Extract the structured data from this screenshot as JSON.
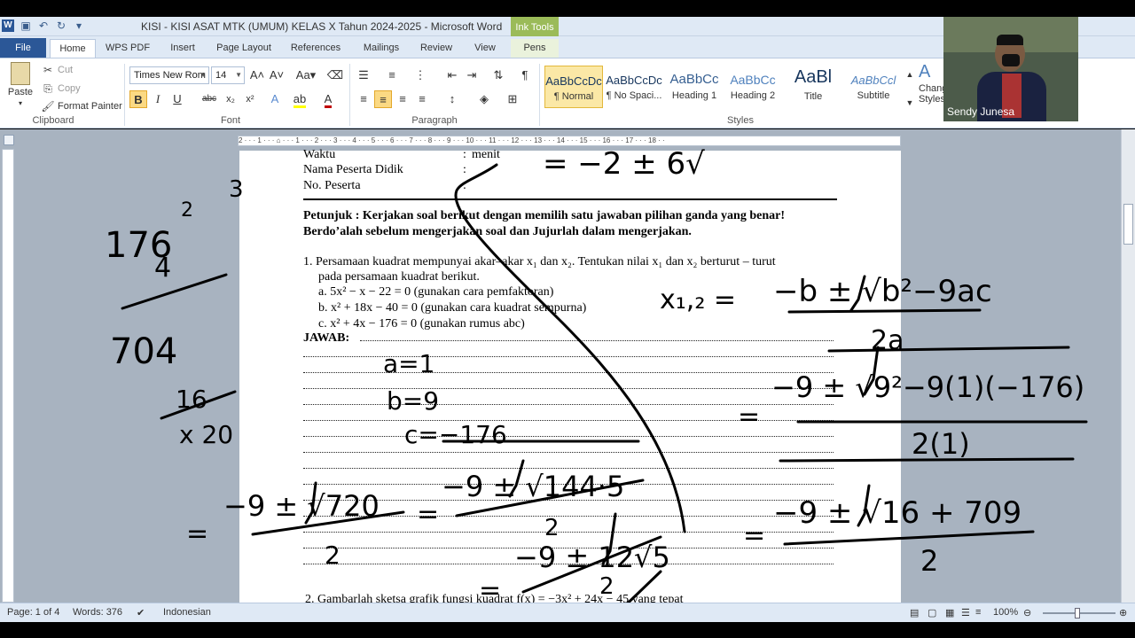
{
  "window": {
    "title": "KISI - KISI ASAT MTK (UMUM) KELAS X Tahun 2024-2025  -  Microsoft Word",
    "contextual_tab_group": "Ink Tools"
  },
  "tabs": [
    {
      "label": "File"
    },
    {
      "label": "Home"
    },
    {
      "label": "WPS PDF"
    },
    {
      "label": "Insert"
    },
    {
      "label": "Page Layout"
    },
    {
      "label": "References"
    },
    {
      "label": "Mailings"
    },
    {
      "label": "Review"
    },
    {
      "label": "View"
    },
    {
      "label": "Pens"
    }
  ],
  "clipboard": {
    "paste": "Paste",
    "cut": "Cut",
    "copy": "Copy",
    "format_painter": "Format Painter",
    "label": "Clipboard"
  },
  "font": {
    "name": "Times New Rom",
    "size": "14",
    "label": "Font",
    "bold": "B",
    "italic": "I",
    "underline": "U",
    "strike": "abc",
    "sub": "x₂",
    "sup": "x²"
  },
  "paragraph": {
    "label": "Paragraph"
  },
  "styles": {
    "label": "Styles",
    "items": [
      {
        "sample": "AaBbCcDc",
        "name": "¶ Normal"
      },
      {
        "sample": "AaBbCcDc",
        "name": "¶ No Spaci..."
      },
      {
        "sample": "AaBbCc",
        "name": "Heading 1"
      },
      {
        "sample": "AaBbCc",
        "name": "Heading 2"
      },
      {
        "sample": "AaBl",
        "name": "Title"
      },
      {
        "sample": "AaBbCcl",
        "name": "Subtitle"
      }
    ],
    "change_styles": "Change Styles"
  },
  "ruler_marks": "2 · · · 1 · · · ⌂ · · · 1 · · · 2 · · · 3 · · · 4 · · · 5 · · · 6 · · · 7 · · · 8 · · · 9 · · · 10 · · · 11 · · · 12 · · · 13 · · · 14 · · · 15 · · · 16 · · · 17 · · · 18 · ·",
  "document": {
    "header_rows": [
      {
        "label": "Waktu",
        "sep": ":",
        "value": "menit"
      },
      {
        "label": "Nama Peserta Didik",
        "sep": ":",
        "value": ""
      },
      {
        "label": "No. Peserta",
        "sep": ":",
        "value": ""
      }
    ],
    "instruction_line1": "Petunjuk : Kerjakan soal berikut dengan memilih satu jawaban pilihan ganda yang benar!",
    "instruction_line2": "Berdo’alah sebelum mengerjakan soal dan Jujurlah dalam mengerjakan.",
    "q1_line1": "1.  Persamaan kuadrat mempunyai akar–akar x₁ dan x₂. Tentukan nilai x₁ dan x₂ berturut – turut",
    "q1_line2": "pada persamaan kuadrat berikut.",
    "q1_a": "a.  5x² − x − 22 = 0 (gunakan cara pemfaktoran)",
    "q1_b": "b.  x² + 18x − 40 = 0 (gunakan cara kuadrat sempurna)",
    "q1_c": "c.  x² + 4x − 176 = 0 (gunakan rumus abc)",
    "answer_label": "JAWAB:",
    "q2_line1": "2.  Gambarlah sketsa grafik fungsi kuadrat f(x) = −3x² + 24x − 45 yang tepat"
  },
  "ink": {
    "top_calc": "= −2 ± 6√",
    "left_a": "176",
    "left_b": "2",
    "left_c": "3",
    "left_d": "4",
    "left_e": "704",
    "left_f": "16",
    "left_g": "x 20",
    "abc_a": "a=1",
    "abc_b": "b=9",
    "abc_c": "c=−176",
    "formula_lhs": "x₁,₂ =",
    "formula_rhs": "−b ± √b²−9ac",
    "formula_den": "2a",
    "sub1_num": "−9 ± √9²−9(1)(−176)",
    "sub1_den": "2(1)",
    "sub2_num": "−9 ± √16 + 709",
    "sub2_den": "2",
    "mid_num": "−9 ± √144·5",
    "mid_den": "2",
    "mid2_num": "−9 ± 12√5",
    "mid2_den": "2",
    "left_num": "−9 ± √720",
    "left_den": "2"
  },
  "status": {
    "page": "Page: 1 of 4",
    "words": "Words: 376",
    "language": "Indonesian",
    "zoom": "100%"
  },
  "webcam": {
    "name": "Sendy Junesa"
  }
}
